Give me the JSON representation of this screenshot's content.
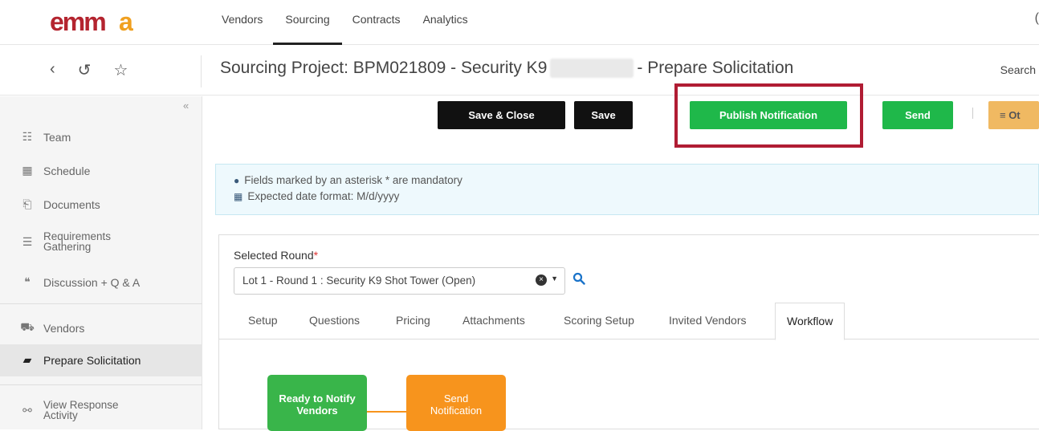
{
  "brand": {
    "logo_text": "emma"
  },
  "topnav": {
    "items": [
      "Vendors",
      "Sourcing",
      "Contracts",
      "Analytics"
    ],
    "active": "Sourcing"
  },
  "header": {
    "title_prefix": "Sourcing Project: BPM021809 - Security K9",
    "title_suffix": "- Prepare Solicitation",
    "search_label": "Search"
  },
  "sidebar": {
    "items": [
      {
        "label": "Team",
        "icon": "team-icon"
      },
      {
        "label": "Schedule",
        "icon": "calendar-icon"
      },
      {
        "label": "Documents",
        "icon": "documents-icon"
      },
      {
        "label_line1": "Requirements",
        "label_line2": "Gathering",
        "icon": "list-icon"
      },
      {
        "label": "Discussion + Q & A",
        "icon": "chat-icon"
      },
      {
        "label": "Vendors",
        "icon": "truck-icon"
      },
      {
        "label": "Prepare Solicitation",
        "icon": "folder-open-icon"
      },
      {
        "label_line1": "View Response",
        "label_line2": "Activity",
        "icon": "binoculars-icon"
      }
    ],
    "active": "Prepare Solicitation"
  },
  "toolbar": {
    "save_close": "Save & Close",
    "save": "Save",
    "publish": "Publish Notification",
    "send": "Send",
    "other": "≡ Ot"
  },
  "info": {
    "line1": "Fields marked by an asterisk * are mandatory",
    "line2": "Expected date format: M/d/yyyy"
  },
  "round": {
    "label": "Selected Round",
    "required_mark": "*",
    "value": "Lot 1 - Round 1 : Security K9 Shot Tower (Open)"
  },
  "tabs": [
    "Setup",
    "Questions",
    "Pricing",
    "Attachments",
    "Scoring Setup",
    "Invited Vendors",
    "Workflow"
  ],
  "active_tab": "Workflow",
  "workflow": {
    "step1_line1": "Ready to Notify",
    "step1_line2": "Vendors",
    "step2_line1": "Send",
    "step2_line2": "Notification"
  },
  "colors": {
    "green": "#1fb84a",
    "dark": "#111111",
    "orange": "#f7941d",
    "highlight": "#b01c33"
  }
}
